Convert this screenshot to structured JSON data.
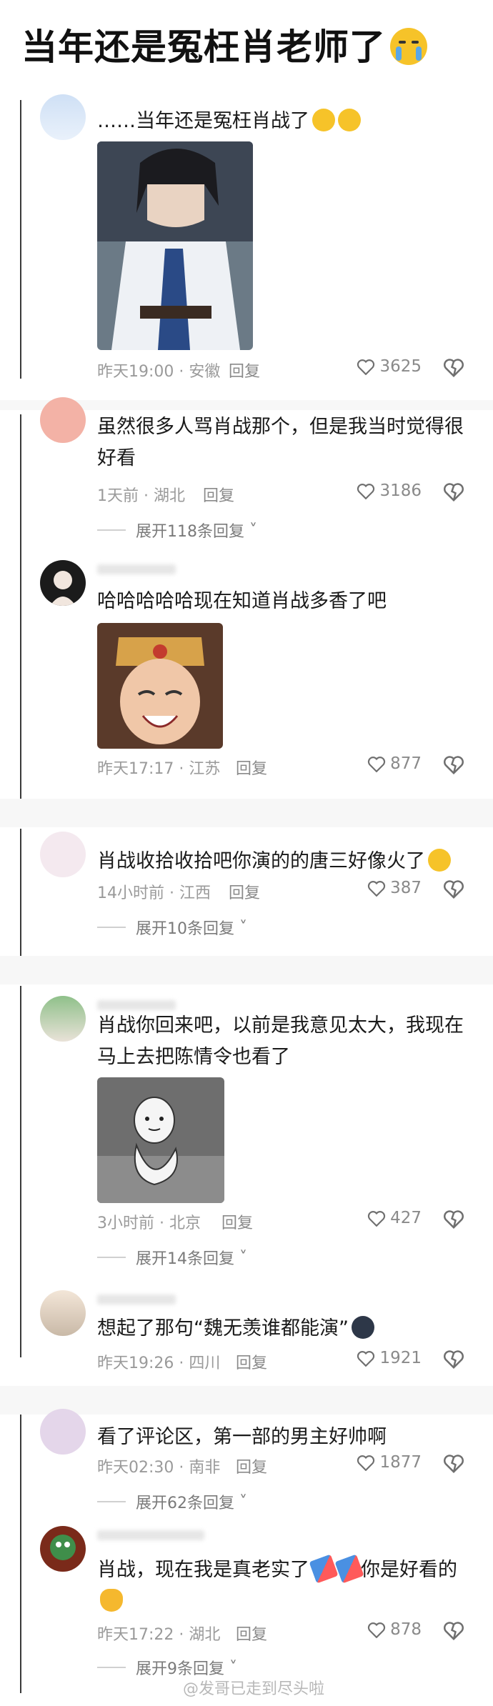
{
  "title": "当年还是冤枉肖老师了",
  "title_emoji": "loudly-crying-face-emoji",
  "comments": [
    {
      "text": "……当年还是冤枉肖战了",
      "time": "昨天19:00 · 安徽",
      "reply": "回复",
      "likes": "3625",
      "has_image": true,
      "image": "costume-portrait",
      "emojis": [
        "dizzy-face-emoji",
        "sweat-smile-emoji"
      ]
    },
    {
      "text": "虽然很多人骂肖战那个，但是我当时觉得很好看",
      "time": "1天前 · 湖北",
      "reply": "回复",
      "likes": "3186",
      "expand": "展开118条回复"
    },
    {
      "text": "哈哈哈哈哈现在知道肖战多香了吧",
      "time": "昨天17:17 · 江苏",
      "reply": "回复",
      "likes": "877",
      "has_image": true,
      "image": "tang-monk-laughing"
    },
    {
      "text": "肖战收拾收拾吧你演的的唐三好像火了",
      "time": "14小时前 · 江西",
      "reply": "回复",
      "likes": "387",
      "expand": "展开10条回复",
      "emojis": [
        "sweat-laugh-emoji"
      ]
    },
    {
      "text": "肖战你回来吧，以前是我意见太大，我现在马上去把陈情令也看了",
      "time": "3小时前 · 北京",
      "reply": "回复",
      "likes": "427",
      "expand": "展开14条回复",
      "has_image": true,
      "image": "sitting-doll-meme"
    },
    {
      "text": "想起了那句“魏无羡谁都能演”",
      "time": "昨天19:26 · 四川",
      "reply": "回复",
      "likes": "1921",
      "emojis": [
        "dark-face-emoji"
      ]
    },
    {
      "text": "看了评论区，第一部的男主好帅啊",
      "time": "昨天02:30 · 南非",
      "reply": "回复",
      "likes": "1877",
      "expand": "展开62条回复"
    },
    {
      "text": "肖战，现在我是真老实了",
      "text_tail": "你是好看的",
      "time": "昨天17:22 · 湖北",
      "reply": "回复",
      "likes": "878",
      "expand": "展开9条回复",
      "emojis": [
        "flag-emoji",
        "flag-emoji",
        "waving-hand-emoji"
      ]
    }
  ],
  "watermark": "@发哥已走到尽头啦",
  "colors": {
    "text": "#1a1a1a",
    "meta": "#9a9a9a",
    "line": "#3a3a3a"
  }
}
